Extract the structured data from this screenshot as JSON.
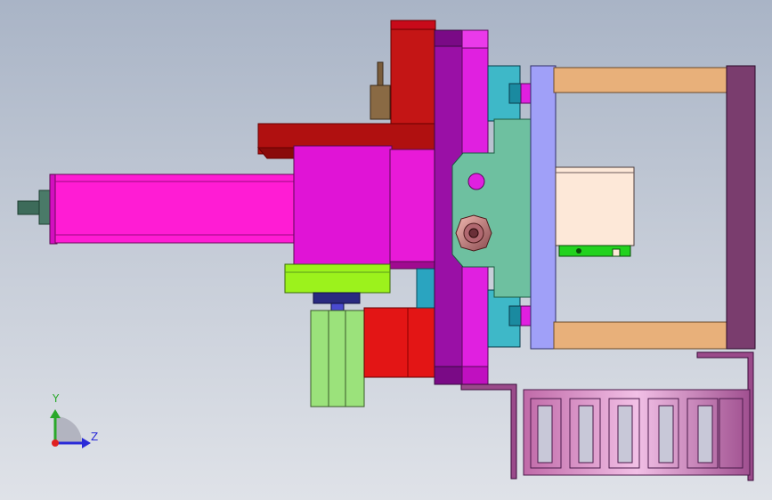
{
  "scene": {
    "kind": "cad-assembly-viewport",
    "view": "side",
    "background_top": "#a9b4c6",
    "background_bottom": "#dfe2e8"
  },
  "triad": {
    "y_label": "Y",
    "z_label": "Z",
    "y_color": "#2aa82a",
    "z_color": "#2a2ad8",
    "x_color": "#e02020"
  },
  "parts": [
    {
      "name": "motor-shaft",
      "color": "#3d6b5a"
    },
    {
      "name": "servo-motor",
      "color": "#ff1cd4"
    },
    {
      "name": "gearbox-block",
      "color": "#e014d6"
    },
    {
      "name": "red-bracket",
      "color": "#c41515"
    },
    {
      "name": "limit-screw",
      "color": "#7a5c3a"
    },
    {
      "name": "lime-adapter",
      "color": "#9cf21c"
    },
    {
      "name": "pneumatic-cylinder",
      "color": "#9be27b"
    },
    {
      "name": "red-clamp",
      "color": "#e31515"
    },
    {
      "name": "purple-plate",
      "color": "#9a10a6"
    },
    {
      "name": "magenta-plate",
      "color": "#e020e0"
    },
    {
      "name": "linear-guide-block",
      "color": "#3eb8c8"
    },
    {
      "name": "slider-plate",
      "color": "#6ec0a0"
    },
    {
      "name": "hex-nut",
      "color": "#d89090"
    },
    {
      "name": "lavender-plate",
      "color": "#a0a0f8"
    },
    {
      "name": "tan-spacer",
      "color": "#e8b07a"
    },
    {
      "name": "end-plate",
      "color": "#7a3d6e"
    },
    {
      "name": "cream-block",
      "color": "#fde8d8"
    },
    {
      "name": "green-profile",
      "color": "#22d21e"
    },
    {
      "name": "cable-chain",
      "color": "#d080c0"
    },
    {
      "name": "l-bracket",
      "color": "#9a4a8a"
    }
  ]
}
